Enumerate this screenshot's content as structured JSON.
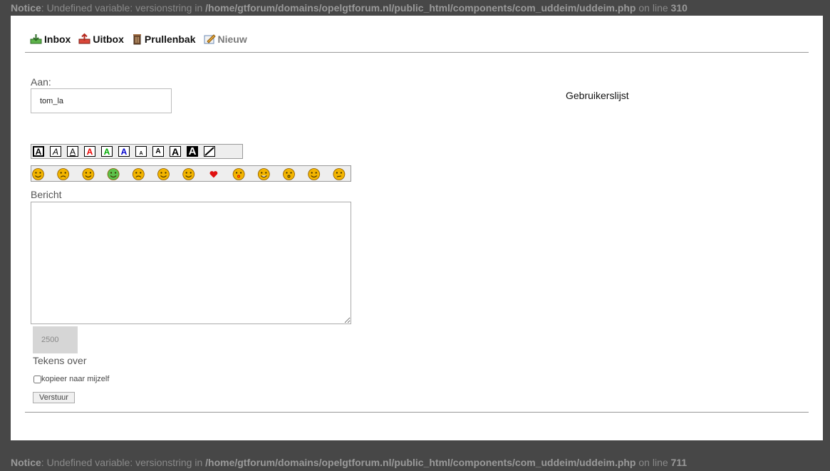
{
  "notices": {
    "top": {
      "prefix": "Notice",
      "message": ": Undefined variable: versionstring in ",
      "path": "/home/gtforum/domains/opelgtforum.nl/public_html/components/com_uddeim/uddeim.php",
      "online": " on line ",
      "line": "310"
    },
    "bottom": {
      "prefix": "Notice",
      "message": ": Undefined variable: versionstring in ",
      "path": "/home/gtforum/domains/opelgtforum.nl/public_html/components/com_uddeim/uddeim.php",
      "online": " on line ",
      "line": "711"
    }
  },
  "nav": {
    "inbox": "Inbox",
    "outbox": "Uitbox",
    "trash": "Prullenbak",
    "new": "Nieuw"
  },
  "form": {
    "to_label": "Aan:",
    "to_value": "tom_la",
    "userlist": "Gebruikerslijst",
    "message_label": "Bericht",
    "chars_left_value": "2500",
    "chars_left_label": "Tekens over",
    "copy_self": "kopieer naar mijzelf",
    "send": "Verstuur"
  },
  "format_buttons": [
    "bold",
    "italic",
    "underline",
    "red",
    "green",
    "blue",
    "small",
    "normal",
    "large",
    "extra-large",
    "clear"
  ],
  "smileys": [
    "smile",
    "sad",
    "tongue",
    "sick",
    "angry",
    "blush",
    "cool",
    "heart",
    "kiss",
    "grin",
    "surprised",
    "wink",
    "confused"
  ],
  "colors": {
    "background": "#474747",
    "panel": "#ffffff",
    "notice_text": "#8a8a8a",
    "smiley": "#f2b400"
  }
}
